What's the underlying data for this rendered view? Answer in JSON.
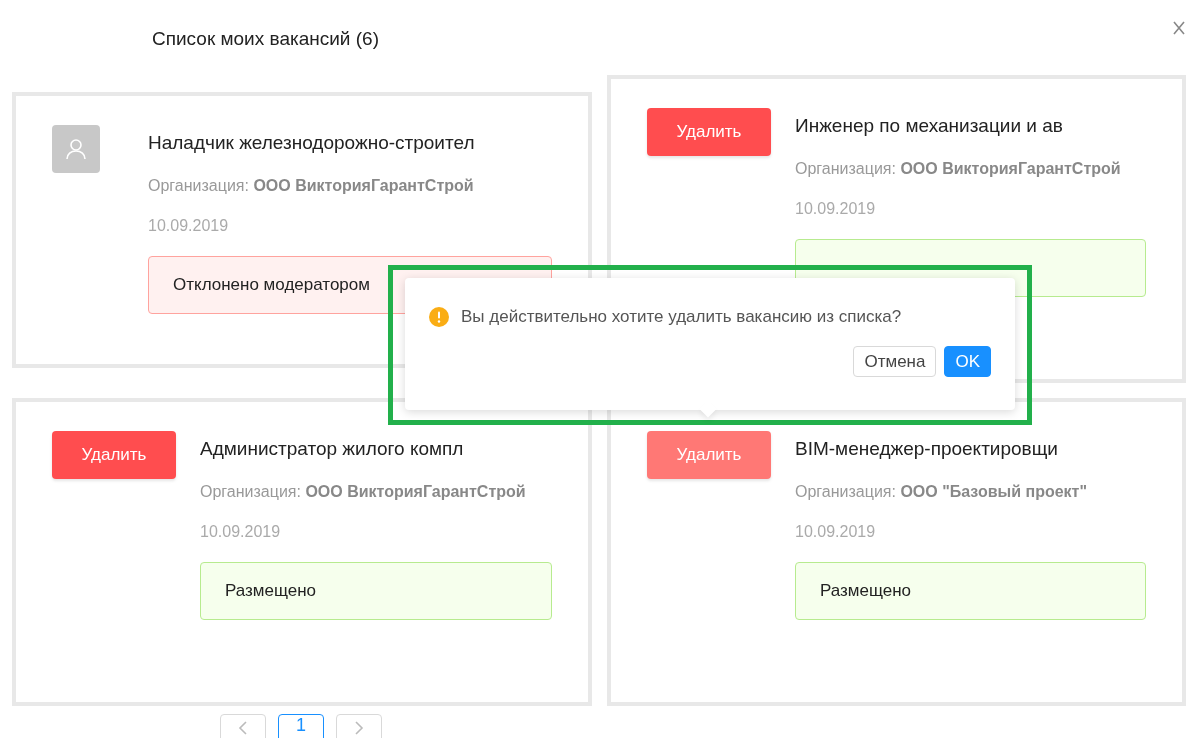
{
  "header": {
    "title": "Список моих вакансий (6)"
  },
  "columns": [
    {
      "cards": [
        {
          "kind": "avatar",
          "title": "Наладчик железнодорожно-строител",
          "org_label": "Организация:",
          "org_name": "ООО ВикторияГарантСтрой",
          "date": "10.09.2019",
          "status": {
            "kind": "rejected",
            "text": "Отклонено модератором"
          }
        },
        {
          "kind": "delete",
          "button": "Удалить",
          "active": false,
          "title": "Администратор жилого компл",
          "org_label": "Организация:",
          "org_name": "ООО ВикторияГарантСтрой",
          "date": "10.09.2019",
          "status": {
            "kind": "published",
            "text": "Размещено"
          }
        }
      ]
    },
    {
      "cards": [
        {
          "kind": "delete",
          "button": "Удалить",
          "active": false,
          "title": "Инженер по механизации и ав",
          "org_label": "Организация:",
          "org_name": "ООО ВикторияГарантСтрой",
          "date": "10.09.2019",
          "status": {
            "kind": "published"
          }
        },
        {
          "kind": "delete",
          "button": "Удалить",
          "active": true,
          "title": "BIM-менеджер-проектировщи",
          "org_label": "Организация:",
          "org_name": "ООО \"Базовый проект\"",
          "date": "10.09.2019",
          "status": {
            "kind": "published",
            "text": "Размещено"
          }
        }
      ]
    }
  ],
  "popconfirm": {
    "message": "Вы действительно хотите удалить вакансию из списка?",
    "cancel": "Отмена",
    "ok": "OK"
  },
  "pagination": [
    {
      "kind": "prev",
      "selected": false
    },
    {
      "kind": "page",
      "label": "1",
      "selected": true
    },
    {
      "kind": "next",
      "selected": false
    }
  ]
}
